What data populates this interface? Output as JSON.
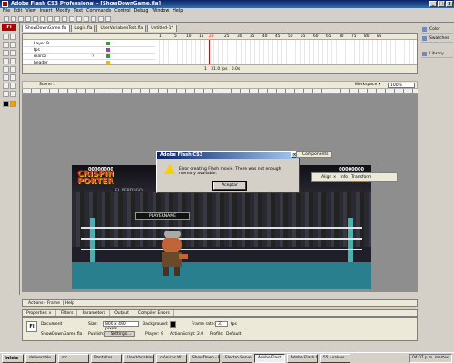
{
  "window": {
    "title": "Adobe Flash CS3 Professional - [ShowDownGame.fla]",
    "buttons": [
      "_",
      "□",
      "x"
    ]
  },
  "menu": [
    "File",
    "Edit",
    "View",
    "Insert",
    "Modify",
    "Text",
    "Commands",
    "Control",
    "Debug",
    "Window",
    "Help"
  ],
  "doc_tabs": [
    "ShowDownGame.fla",
    "Login.fla",
    "UserVariablesTest.fla",
    "Untitled-1*"
  ],
  "timeline": {
    "layers": [
      "Layer 9",
      "fps",
      "marco",
      "header"
    ],
    "frame_numbers": [
      "1",
      "5",
      "10",
      "15",
      "20",
      "25",
      "30",
      "35",
      "40",
      "45",
      "50",
      "55",
      "60",
      "65",
      "70",
      "75",
      "80",
      "85"
    ],
    "footer": {
      "frame": "1",
      "fps": "31.0 fps",
      "time": "0.0s"
    }
  },
  "scene": {
    "label": "Scene 1",
    "workspace": "Workspace ▾",
    "zoom": "100%"
  },
  "stage": {
    "score_left": "00000000",
    "score_right": "00000000",
    "logo_left": [
      "CRISPIN",
      "PORTER"
    ],
    "subtitle": "EL VERDUGO",
    "playername": "PLAYERNAME",
    "right_logo_fragment": "6000"
  },
  "dialog": {
    "title": "Adobe Flash CS3",
    "message": "Error creating Flash movie. There was not enough memory available.",
    "button": "Aceptar"
  },
  "floating_panels": {
    "components": "Components",
    "align_tabs": [
      "Align ×",
      "Info",
      "Transform"
    ]
  },
  "right_dock": [
    "Color",
    "Swatches",
    "Library"
  ],
  "bottom_panels": {
    "actions": "Actions - Frame",
    "help": "Help",
    "prop_tabs": [
      "Properties ×",
      "Filters",
      "Parameters",
      "Output",
      "Compiler Errors"
    ]
  },
  "properties": {
    "type": "Document",
    "name": "ShowDownGame.fla",
    "size_label": "Size:",
    "size_value": "800 x 490 pixels",
    "background_label": "Background:",
    "frame_rate_label": "Frame rate:",
    "frame_rate_value": "31",
    "fps_unit": "fps",
    "publish_label": "Publish:",
    "settings_button": "Settings...",
    "player_label": "Player:",
    "player_value": "9",
    "actionscript_label": "ActionScript:",
    "actionscript_value": "2.0",
    "profile_label": "Profile:",
    "profile_value": "Default"
  },
  "taskbar": {
    "start": "Inicio",
    "tasks": [
      "deliverable",
      "src",
      "Pantallas",
      "UserVariables",
      "crónicas W",
      "ShowDown - Fla",
      "Electro Server",
      "Adobe Flash...",
      "Adobe Flash CS3",
      "55 - valves"
    ],
    "clock": "04:07 p.m.",
    "day": "martes"
  }
}
